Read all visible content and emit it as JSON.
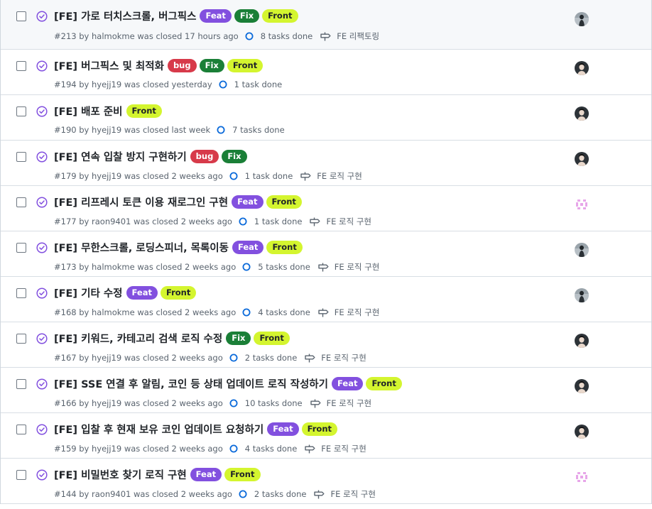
{
  "colors": {
    "done_purple": "#8250df",
    "feat": {
      "bg": "#8250df",
      "fg": "#ffffff"
    },
    "fix": {
      "bg": "#1a7f37",
      "fg": "#ffffff"
    },
    "front": {
      "bg": "#d4f52f",
      "fg": "#1f2328"
    },
    "bug": {
      "bg": "#d73a4a",
      "fg": "#ffffff"
    }
  },
  "issues": [
    {
      "title": "[FE] 가로 터치스크롤, 버그픽스",
      "labels": [
        {
          "text": "Feat",
          "kind": "feat"
        },
        {
          "text": "Fix",
          "kind": "fix"
        },
        {
          "text": "Front",
          "kind": "front"
        }
      ],
      "meta": "#213 by halmokme was closed 17 hours ago",
      "tasks": "8 tasks done",
      "milestone": "FE 리팩토링",
      "avatar": "halmokme"
    },
    {
      "title": "[FE] 버그픽스 및 최적화",
      "labels": [
        {
          "text": "bug",
          "kind": "bug"
        },
        {
          "text": "Fix",
          "kind": "fix"
        },
        {
          "text": "Front",
          "kind": "front"
        }
      ],
      "meta": "#194 by hyejj19 was closed yesterday",
      "tasks": "1 task done",
      "milestone": "",
      "avatar": "hyejj19"
    },
    {
      "title": "[FE] 배포 준비",
      "labels": [
        {
          "text": "Front",
          "kind": "front"
        }
      ],
      "meta": "#190 by hyejj19 was closed last week",
      "tasks": "7 tasks done",
      "milestone": "",
      "avatar": "hyejj19"
    },
    {
      "title": "[FE] 연속 입찰 방지 구현하기",
      "labels": [
        {
          "text": "bug",
          "kind": "bug"
        },
        {
          "text": "Fix",
          "kind": "fix"
        }
      ],
      "meta": "#179 by hyejj19 was closed 2 weeks ago",
      "tasks": "1 task done",
      "milestone": "FE 로직 구현",
      "avatar": "hyejj19"
    },
    {
      "title": "[FE] 리프레시 토큰 이용 재로그인 구현",
      "labels": [
        {
          "text": "Feat",
          "kind": "feat"
        },
        {
          "text": "Front",
          "kind": "front"
        }
      ],
      "meta": "#177 by raon9401 was closed 2 weeks ago",
      "tasks": "1 task done",
      "milestone": "FE 로직 구현",
      "avatar": "raon9401"
    },
    {
      "title": "[FE] 무한스크롤, 로딩스피너, 목록이동",
      "labels": [
        {
          "text": "Feat",
          "kind": "feat"
        },
        {
          "text": "Front",
          "kind": "front"
        }
      ],
      "meta": "#173 by halmokme was closed 2 weeks ago",
      "tasks": "5 tasks done",
      "milestone": "FE 로직 구현",
      "avatar": "halmokme"
    },
    {
      "title": "[FE] 기타 수정",
      "labels": [
        {
          "text": "Feat",
          "kind": "feat"
        },
        {
          "text": "Front",
          "kind": "front"
        }
      ],
      "meta": "#168 by halmokme was closed 2 weeks ago",
      "tasks": "4 tasks done",
      "milestone": "FE 로직 구현",
      "avatar": "halmokme"
    },
    {
      "title": "[FE] 키워드, 카테고리 검색 로직 수정",
      "labels": [
        {
          "text": "Fix",
          "kind": "fix"
        },
        {
          "text": "Front",
          "kind": "front"
        }
      ],
      "meta": "#167 by hyejj19 was closed 2 weeks ago",
      "tasks": "2 tasks done",
      "milestone": "FE 로직 구현",
      "avatar": "hyejj19"
    },
    {
      "title": "[FE] SSE 연결 후 알림, 코인 등 상태 업데이트 로직 작성하기",
      "labels": [
        {
          "text": "Feat",
          "kind": "feat"
        },
        {
          "text": "Front",
          "kind": "front"
        }
      ],
      "meta": "#166 by hyejj19 was closed 2 weeks ago",
      "tasks": "10 tasks done",
      "milestone": "FE 로직 구현",
      "avatar": "hyejj19"
    },
    {
      "title": "[FE] 입찰 후 현재 보유 코인 업데이트 요청하기",
      "labels": [
        {
          "text": "Feat",
          "kind": "feat"
        },
        {
          "text": "Front",
          "kind": "front"
        }
      ],
      "meta": "#159 by hyejj19 was closed 2 weeks ago",
      "tasks": "4 tasks done",
      "milestone": "FE 로직 구현",
      "avatar": "hyejj19"
    },
    {
      "title": "[FE] 비밀번호 찾기 로직 구현",
      "labels": [
        {
          "text": "Feat",
          "kind": "feat"
        },
        {
          "text": "Front",
          "kind": "front"
        }
      ],
      "meta": "#144 by raon9401 was closed 2 weeks ago",
      "tasks": "2 tasks done",
      "milestone": "FE 로직 구현",
      "avatar": "raon9401"
    }
  ]
}
